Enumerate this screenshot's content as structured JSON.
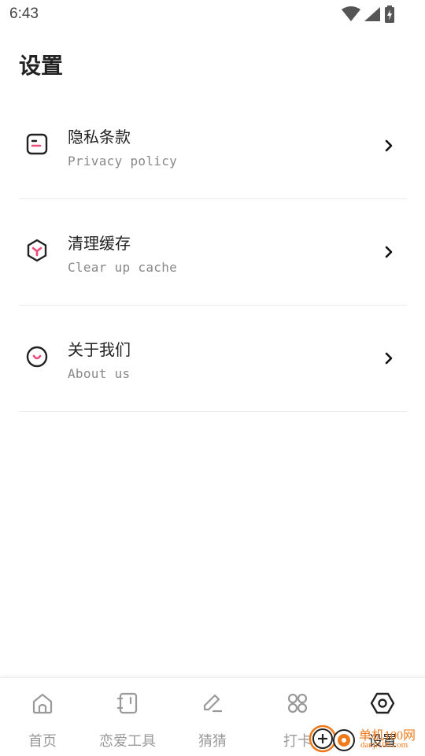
{
  "status_bar": {
    "time": "6:43",
    "icons": [
      "wifi-icon",
      "signal-icon",
      "battery-charging-icon"
    ]
  },
  "page": {
    "title": "设置"
  },
  "settings": [
    {
      "title": "隐私条款",
      "subtitle": "Privacy policy",
      "icon": "privacy-document-icon"
    },
    {
      "title": "清理缓存",
      "subtitle": "Clear up cache",
      "icon": "cache-cube-icon"
    },
    {
      "title": "关于我们",
      "subtitle": "About us",
      "icon": "about-smile-icon"
    }
  ],
  "bottom_nav": [
    {
      "label": "首页",
      "icon": "home-icon",
      "active": false
    },
    {
      "label": "恋爱工具",
      "icon": "notebook-icon",
      "active": false
    },
    {
      "label": "猜猜",
      "icon": "pencil-icon",
      "active": false
    },
    {
      "label": "打卡",
      "icon": "grid-icon",
      "active": false
    },
    {
      "label": "设置",
      "icon": "settings-hexagon-icon",
      "active": true
    }
  ],
  "watermark": {
    "text": "单机100网",
    "sub": "danji100.com"
  },
  "colors": {
    "accent": "#f04a7a",
    "icon_stroke": "#222222",
    "inactive": "#9a9a9a",
    "watermark": "#f07a1a"
  }
}
